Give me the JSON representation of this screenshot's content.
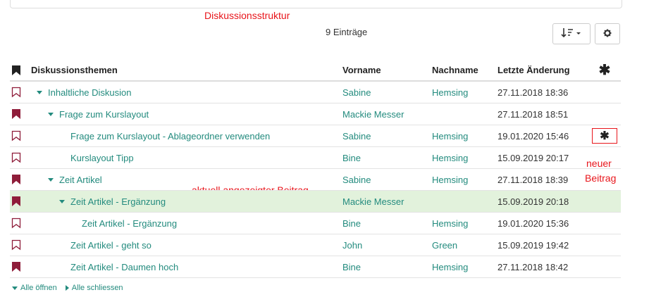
{
  "annotations": {
    "title": "Diskussionsstruktur",
    "current": "aktuell angezeigter Beitrag",
    "new_line1": "neuer",
    "new_line2": "Beitrag"
  },
  "toolbar": {
    "entries_count": "9 Einträge",
    "sort_icon": "sort-icon",
    "settings_icon": "gear-icon"
  },
  "table": {
    "headers": {
      "topic": "Diskussionsthemen",
      "first": "Vorname",
      "last": "Nachname",
      "date": "Letzte Änderung",
      "new": "✱"
    },
    "rows": [
      {
        "topic": "Inhaltliche Diskusion",
        "first": "Sabine",
        "last": "Hemsing",
        "date": "27.11.2018 18:36",
        "bookmarked": false,
        "level": 0,
        "expander": true
      },
      {
        "topic": "Frage zum Kurslayout",
        "first": "Mackie Messer",
        "last": "",
        "date": "27.11.2018 18:51",
        "bookmarked": true,
        "level": 1,
        "expander": true
      },
      {
        "topic": "Frage zum Kurslayout - Ablageordner verwenden",
        "first": "Sabine",
        "last": "Hemsing",
        "date": "19.01.2020 15:46",
        "bookmarked": false,
        "level": 2,
        "expander": false,
        "new_marker": "✱"
      },
      {
        "topic": "Kurslayout Tipp",
        "first": "Bine",
        "last": "Hemsing",
        "date": "15.09.2019 20:17",
        "bookmarked": false,
        "level": 2,
        "expander": false
      },
      {
        "topic": "Zeit Artikel",
        "first": "Sabine",
        "last": "Hemsing",
        "date": "27.11.2018 18:39",
        "bookmarked": true,
        "level": 1,
        "expander": true
      },
      {
        "topic": "Zeit Artikel - Ergänzung",
        "first": "Mackie Messer",
        "last": "",
        "date": "15.09.2019 20:18",
        "bookmarked": true,
        "level": 2,
        "expander": true,
        "selected": true
      },
      {
        "topic": "Zeit Artikel - Ergänzung",
        "first": "Bine",
        "last": "Hemsing",
        "date": "19.01.2020 15:36",
        "bookmarked": false,
        "level": 3,
        "expander": false
      },
      {
        "topic": "Zeit Artikel - geht so",
        "first": "John",
        "last": "Green",
        "date": "15.09.2019 19:42",
        "bookmarked": false,
        "level": 2,
        "expander": false
      },
      {
        "topic": "Zeit Artikel - Daumen hoch",
        "first": "Bine",
        "last": "Hemsing",
        "date": "27.11.2018 18:42",
        "bookmarked": true,
        "level": 2,
        "expander": false
      }
    ]
  },
  "footer": {
    "open_all": "Alle öffnen",
    "close_all": "Alle schliessen"
  },
  "colors": {
    "accent": "#238b7e",
    "bookmark": "#8f1d3a",
    "annotation": "#e8151b",
    "selected_row": "#e2f2dc"
  }
}
